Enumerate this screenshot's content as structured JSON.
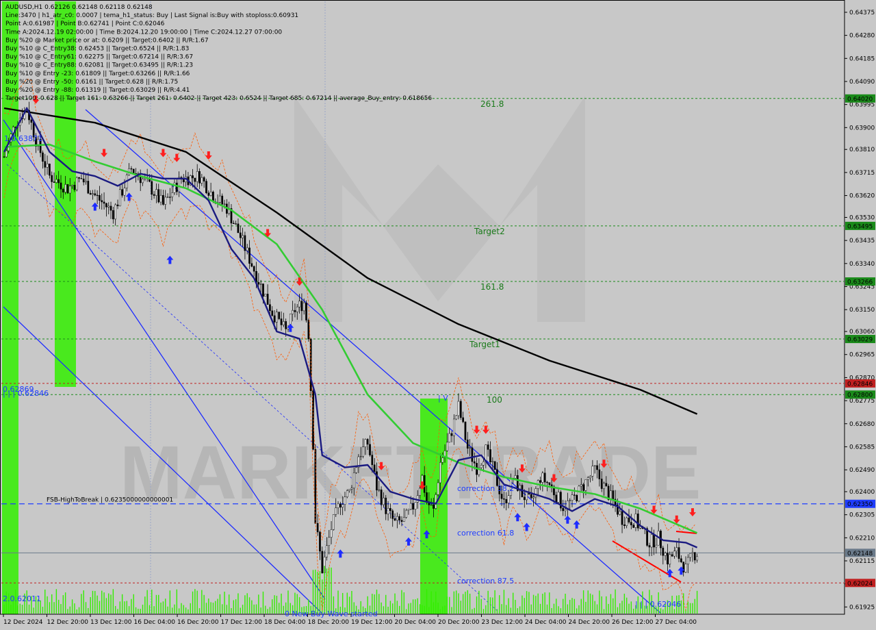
{
  "header": {
    "lines": [
      "AUDUSD,H1  0.62126 0.62148 0.62118 0.62148",
      "Line:3470 | h1_atr_c0: 0.0007 | tema_h1_status: Buy | Last Signal is:Buy with stoploss:0.60931",
      "Point A:0.61987 | Point B:0.62741 | Point C:0.62046",
      "Time A:2024.12.19 02:00:00 | Time B:2024.12.20 19:00:00 | Time C:2024.12.27 07:00:00",
      "Buy %20 @ Market price or at: 0.6209 || Target:0.6402 || R/R:1.67",
      "Buy %10 @ C_Entry38: 0.62453 || Target:0.6524 || R/R:1.83",
      "Buy %10 @ C_Entry61: 0.62275 || Target:0.67214 || R/R:3.67",
      "Buy %10 @ C_Entry88: 0.62081 || Target:0.63495 || R/R:1.23",
      "Buy %10 @ Entry -23: 0.61809 || Target:0.63266 || R/R:1.66",
      "Buy %20 @ Entry -50: 0.6161 || Target:0.628 || R/R:1.75",
      "Buy %20 @ Entry -88: 0.61319 || Target:0.63029 || R/R:4.41",
      "Target100: 0.628 || Target 161: 0.63266 || Target 261: 0.6402 || Target 423: 0.6524 || Target 685: 0.67214 || average_Buy_entry: 0.618656"
    ]
  },
  "watermark": "MARKETTRADE",
  "price_levels": [
    {
      "price": 0.6402,
      "label": "261.8",
      "tag": "0.64020",
      "color": "#1a8a1a"
    },
    {
      "price": 0.63495,
      "label": "Target2",
      "tag": "0.63495",
      "color": "#1a8a1a"
    },
    {
      "price": 0.63266,
      "label": "161.8",
      "tag": "0.63266",
      "color": "#1a8a1a"
    },
    {
      "price": 0.63029,
      "label": "Target1",
      "tag": "0.63029",
      "color": "#1a8a1a"
    },
    {
      "price": 0.62846,
      "label": "",
      "tag": "0.62846",
      "color": "#c02020"
    },
    {
      "price": 0.628,
      "label": "100",
      "tag": "0.62800",
      "color": "#1a8a1a"
    },
    {
      "price": 0.6235,
      "label": "FSB-HighToBreak | 0.6235000000000001",
      "tag": "0.62350",
      "color": "#1e3cff"
    },
    {
      "price": 0.62148,
      "label": "",
      "tag": "0.62148",
      "color": "#6a7a8a"
    },
    {
      "price": 0.62024,
      "label": "",
      "tag": "0.62024",
      "color": "#c02020"
    }
  ],
  "annotations": [
    {
      "text": "correction 38.2"
    },
    {
      "text": "correction 61.8"
    },
    {
      "text": "correction 87.5"
    },
    {
      "text": "0 New Buy Wave started"
    },
    {
      "text": "| | | 0.62046"
    },
    {
      "text": "0.62869"
    },
    {
      "text": "| | | 0.62846"
    },
    {
      "text": "2.0.62011"
    },
    {
      "text": "1.0.63871"
    },
    {
      "text": "| V"
    }
  ],
  "chart_data": {
    "type": "line",
    "title": "AUDUSD,H1",
    "ohlc_last": {
      "open": 0.62126,
      "high": 0.62148,
      "low": 0.62118,
      "close": 0.62148
    },
    "y_ticks": [
      0.64375,
      0.6428,
      0.64185,
      0.6409,
      0.63995,
      0.639,
      0.6381,
      0.63715,
      0.6362,
      0.6353,
      0.63435,
      0.6334,
      0.63245,
      0.6315,
      0.6306,
      0.62965,
      0.6287,
      0.62775,
      0.6268,
      0.62585,
      0.6249,
      0.624,
      0.62305,
      0.6221,
      0.62115,
      0.6202,
      0.61925
    ],
    "x_ticks": [
      "12 Dec 2024",
      "12 Dec 20:00",
      "13 Dec 12:00",
      "16 Dec 04:00",
      "16 Dec 20:00",
      "17 Dec 12:00",
      "18 Dec 04:00",
      "18 Dec 20:00",
      "19 Dec 12:00",
      "20 Dec 04:00",
      "20 Dec 20:00",
      "23 Dec 12:00",
      "24 Dec 04:00",
      "24 Dec 20:00",
      "26 Dec 12:00",
      "27 Dec 04:00"
    ],
    "ylim": [
      0.61895,
      0.6442
    ],
    "series": [
      {
        "color": "#000000",
        "x": [
          0,
          40,
          80,
          120,
          160,
          200,
          240,
          280,
          305
        ],
        "values": [
          0.6398,
          0.6392,
          0.638,
          0.6355,
          0.6328,
          0.6309,
          0.6294,
          0.6282,
          0.6272
        ]
      },
      {
        "color": "#33cc33",
        "x": [
          0,
          20,
          40,
          60,
          80,
          100,
          120,
          140,
          160,
          180,
          200,
          220,
          240,
          260,
          280,
          305
        ],
        "values": [
          0.6382,
          0.6383,
          0.6376,
          0.637,
          0.6365,
          0.6356,
          0.6342,
          0.6315,
          0.628,
          0.626,
          0.6252,
          0.6246,
          0.6242,
          0.6239,
          0.6233,
          0.6223
        ]
      },
      {
        "color": "#1a1a80",
        "x": [
          0,
          10,
          20,
          30,
          40,
          50,
          60,
          70,
          80,
          90,
          100,
          110,
          120,
          130,
          137,
          140,
          150,
          160,
          170,
          180,
          190,
          200,
          210,
          220,
          230,
          240,
          250,
          260,
          270,
          280,
          290,
          300,
          305
        ],
        "values": [
          0.638,
          0.6398,
          0.638,
          0.6372,
          0.637,
          0.6366,
          0.6371,
          0.6369,
          0.6369,
          0.636,
          0.634,
          0.6328,
          0.6306,
          0.6303,
          0.628,
          0.6255,
          0.625,
          0.6251,
          0.624,
          0.6237,
          0.6235,
          0.6253,
          0.6255,
          0.6243,
          0.624,
          0.6237,
          0.6232,
          0.6237,
          0.6234,
          0.6226,
          0.622,
          0.6219,
          0.6217
        ]
      }
    ]
  }
}
